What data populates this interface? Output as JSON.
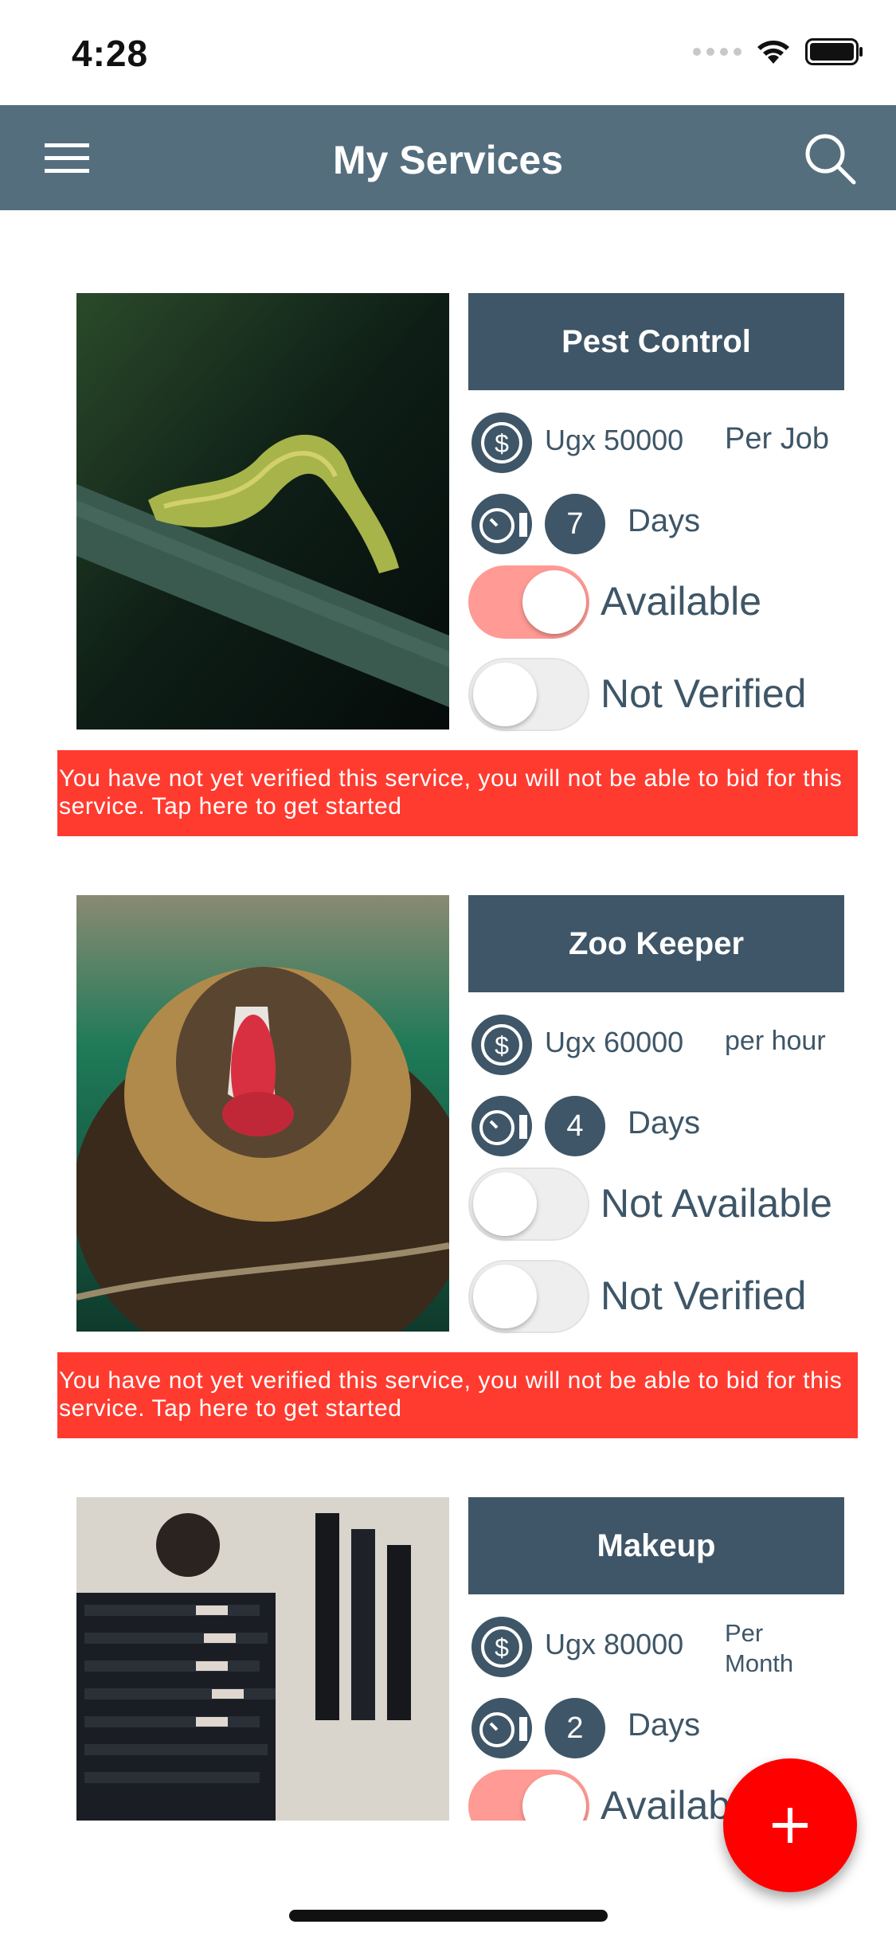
{
  "status_bar": {
    "time": "4:28"
  },
  "nav": {
    "title": "My Services",
    "menu_icon": "hamburger-menu-icon",
    "search_icon": "search-icon"
  },
  "services": [
    {
      "title": "Pest Control",
      "price": "Ugx 50000",
      "unit": "Per Job",
      "days_count": "7",
      "days_label": "Days",
      "availability_on": true,
      "availability_label": "Available",
      "verified_on": false,
      "verified_label": "Not Verified",
      "warning": "You have not yet verified this service, you will not be able to bid for this service. Tap here to get started"
    },
    {
      "title": "Zoo Keeper",
      "price": "Ugx 60000",
      "unit": "per hour",
      "days_count": "4",
      "days_label": "Days",
      "availability_on": false,
      "availability_label": "Not Available",
      "verified_on": false,
      "verified_label": "Not Verified",
      "warning": "You have not yet verified this service, you will not be able to bid for this service. Tap here to get started"
    },
    {
      "title": "Makeup",
      "price": "Ugx 80000",
      "unit": "Per Month",
      "days_count": "2",
      "days_label": "Days",
      "availability_on": true,
      "availability_label": "Available"
    }
  ],
  "fab": {
    "icon": "plus-icon"
  },
  "colors": {
    "nav": "#546e7e",
    "title_bar": "#3e5667",
    "warning": "#ff3b30",
    "toggle_on": "#ff9a94",
    "fab": "#ff0000"
  }
}
